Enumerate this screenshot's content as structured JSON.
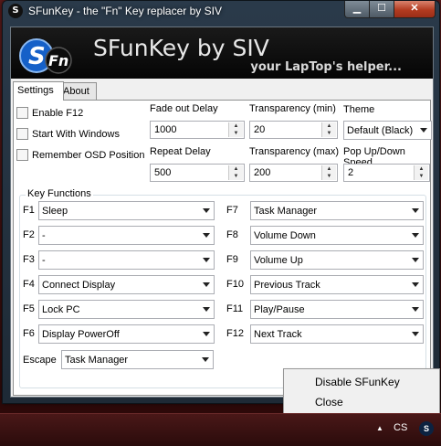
{
  "window": {
    "title": "SFunKey - the \"Fn\" Key replacer by SIV",
    "icon_glyph": "S",
    "controls": {
      "minimize": "▁",
      "maximize": "☐",
      "close": "✕"
    }
  },
  "banner": {
    "logo_s": "S",
    "logo_fn": "Fn",
    "title": "SFunKey by SIV",
    "subtitle": "your LapTop's helper..."
  },
  "tabs": [
    {
      "label": "Settings",
      "active": true
    },
    {
      "label": "About",
      "active": false
    }
  ],
  "settings": {
    "checkboxes": [
      {
        "label": "Enable F12",
        "checked": false
      },
      {
        "label": "Start With Windows",
        "checked": false
      },
      {
        "label": "Remember OSD Position",
        "checked": false
      }
    ],
    "fade_out_delay": {
      "label": "Fade out Delay",
      "value": "1000"
    },
    "transparency_min": {
      "label": "Transparency (min)",
      "value": "20"
    },
    "theme": {
      "label": "Theme",
      "value": "Default (Black)"
    },
    "repeat_delay": {
      "label": "Repeat Delay",
      "value": "500"
    },
    "transparency_max": {
      "label": "Transparency (max)",
      "value": "200"
    },
    "popup_speed": {
      "label": "Pop Up/Down Speed",
      "value": "2"
    }
  },
  "key_functions": {
    "title": "Key Functions",
    "left": [
      {
        "key": "F1",
        "value": "Sleep"
      },
      {
        "key": "F2",
        "value": "-"
      },
      {
        "key": "F3",
        "value": "-"
      },
      {
        "key": "F4",
        "value": "Connect Display"
      },
      {
        "key": "F5",
        "value": "Lock PC"
      },
      {
        "key": "F6",
        "value": "Display PowerOff"
      }
    ],
    "right": [
      {
        "key": "F7",
        "value": "Task Manager"
      },
      {
        "key": "F8",
        "value": "Volume Down"
      },
      {
        "key": "F9",
        "value": "Volume Up"
      },
      {
        "key": "F10",
        "value": "Previous Track"
      },
      {
        "key": "F11",
        "value": "Play/Pause"
      },
      {
        "key": "F12",
        "value": "Next Track"
      }
    ],
    "escape": {
      "key": "Escape",
      "value": "Task Manager"
    }
  },
  "context_menu": {
    "items": [
      "Disable SFunKey",
      "Close"
    ]
  },
  "taskbar": {
    "language": "CS",
    "tray_glyph": "S",
    "show_hidden": "▲"
  }
}
